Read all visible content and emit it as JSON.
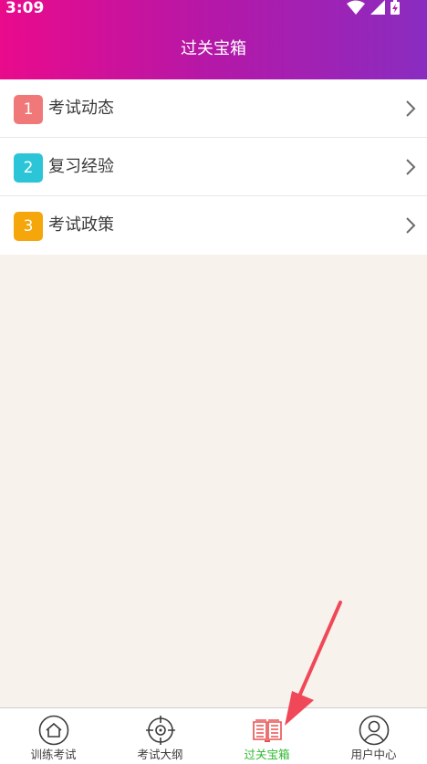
{
  "status": {
    "time": "3:09"
  },
  "header": {
    "title": "过关宝箱"
  },
  "list": {
    "items": [
      {
        "number": "1",
        "label": "考试动态",
        "color": "#f07878"
      },
      {
        "number": "2",
        "label": "复习经验",
        "color": "#2cc5d8"
      },
      {
        "number": "3",
        "label": "考试政策",
        "color": "#f5a60a"
      }
    ]
  },
  "tabs": [
    {
      "label": "训练考试",
      "icon": "home-icon"
    },
    {
      "label": "考试大纲",
      "icon": "target-icon"
    },
    {
      "label": "过关宝箱",
      "icon": "book-icon",
      "active": true
    },
    {
      "label": "用户中心",
      "icon": "user-icon"
    }
  ],
  "colors": {
    "active_tab": "#2eb82e",
    "active_icon": "#e85050",
    "header_start": "#ea0a8c",
    "header_end": "#8a2cc0",
    "annotation": "#f04858"
  }
}
